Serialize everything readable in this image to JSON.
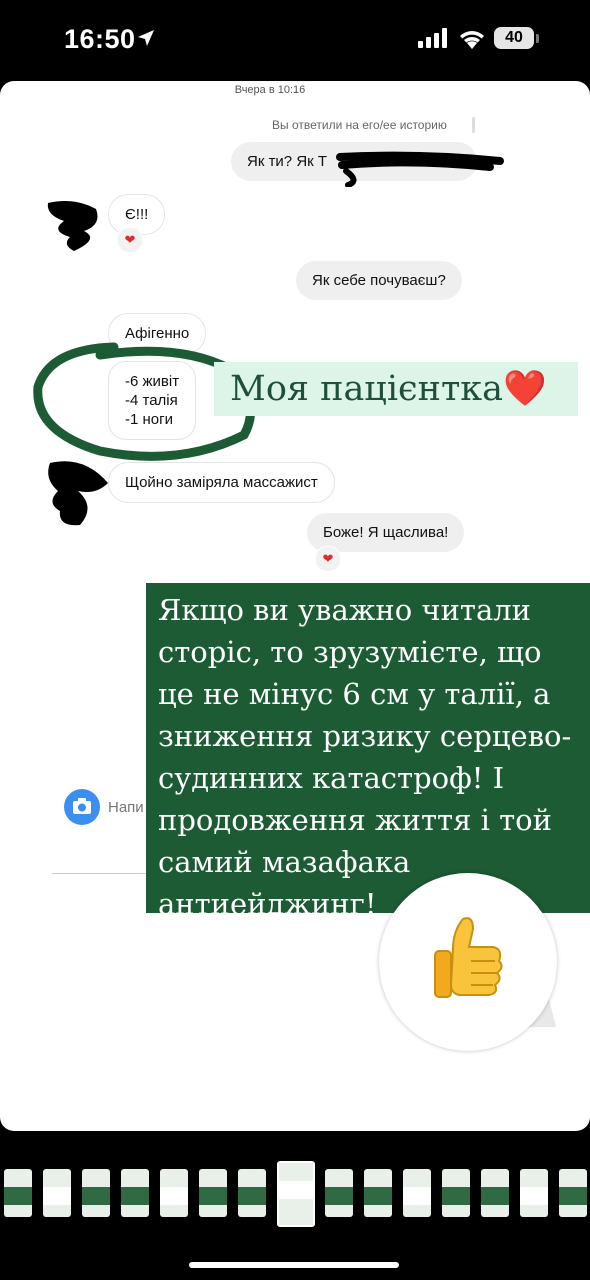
{
  "status_bar": {
    "time": "16:50",
    "battery": "40"
  },
  "chat": {
    "timestamp": "Вчера в 10:16",
    "reply_note": "Вы ответили на его/ее историю",
    "messages": [
      {
        "side": "out",
        "text": "Як ти? Як Т"
      },
      {
        "side": "in",
        "text": "Є!!!",
        "reaction": "❤"
      },
      {
        "side": "out",
        "text": "Як себе почуваєш?"
      },
      {
        "side": "in",
        "text": "Афігенно"
      },
      {
        "side": "in",
        "lines": [
          "-6 живіт",
          "-4 талія",
          "-1 ноги"
        ]
      },
      {
        "side": "in",
        "text": "Щойно заміряла массажист"
      },
      {
        "side": "out",
        "text": "Боже! Я щаслива!",
        "reaction": "❤"
      }
    ],
    "input_placeholder": "Напи"
  },
  "overlay": {
    "title": "Моя пацієнтка",
    "title_heart": "❤️",
    "note": "Якщо ви уважно читали\nсторіс, то зрузумієте, що\nце не мінус 6 см у талії, а\nзниження ризику серцево-\nсудинних катастроф! І\nпродовження життя і той\nсамий мазафака\nантиейджинг!",
    "sticker_icon": "thumbs-up-icon"
  },
  "thumbnail_strip": {
    "count": 15,
    "selected_index": 7
  },
  "colors": {
    "accent_green": "#1c5b34",
    "title_bg": "#ddf5e9",
    "heart_red": "#e02b2b"
  }
}
